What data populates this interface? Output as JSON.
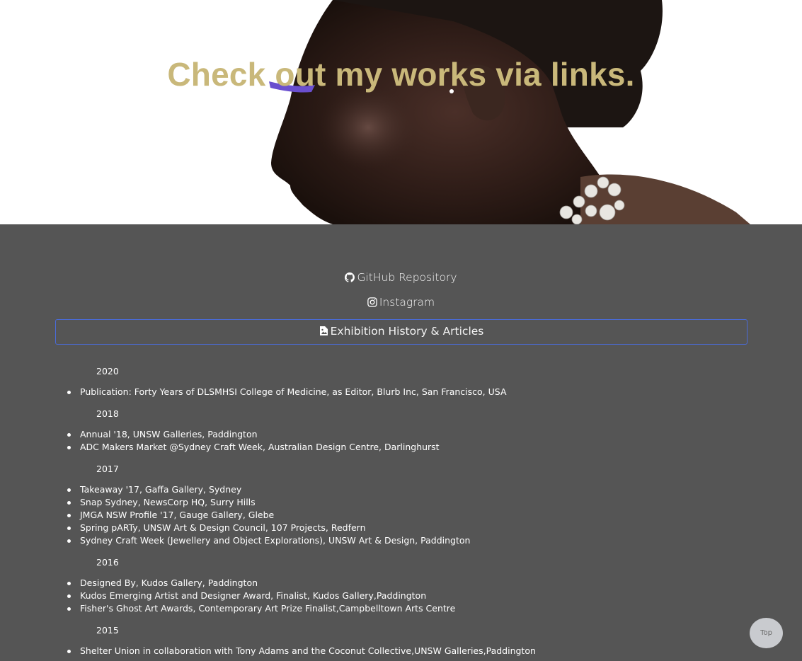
{
  "hero": {
    "title": "Check out my works via links."
  },
  "links": {
    "github": {
      "label": "GitHub Repository",
      "icon": "github-icon"
    },
    "instagram": {
      "label": "Instagram",
      "icon": "instagram-icon"
    },
    "exhibition": {
      "label": "Exhibition History & Articles",
      "icon": "image-file-icon"
    }
  },
  "history": [
    {
      "year": "2020",
      "items": [
        "Publication: Forty Years of DLSMHSI College of Medicine, as Editor, Blurb Inc, San Francisco, USA"
      ]
    },
    {
      "year": "2018",
      "items": [
        "Annual '18, UNSW Galleries, Paddington",
        "ADC Makers Market @Sydney Craft Week, Australian Design Centre, Darlinghurst"
      ]
    },
    {
      "year": "2017",
      "items": [
        "Takeaway '17, Gaffa Gallery, Sydney",
        "Snap Sydney, NewsCorp HQ, Surry Hills",
        "JMGA NSW Profile '17, Gauge Gallery, Glebe",
        "Spring pARTy, UNSW Art & Design Council, 107 Projects, Redfern",
        "Sydney Craft Week (Jewellery and Object Explorations), UNSW Art & Design, Paddington"
      ]
    },
    {
      "year": "2016",
      "items": [
        "Designed By, Kudos Gallery, Paddington",
        "Kudos Emerging Artist and Designer Award, Finalist, Kudos Gallery,Paddington",
        "Fisher's Ghost Art Awards, Contemporary Art Prize Finalist,Campbelltown Arts Centre"
      ]
    },
    {
      "year": "2015",
      "items": [
        "Shelter Union in collaboration with Tony Adams and the Coconut Collective,UNSW Galleries,Paddington"
      ]
    }
  ],
  "top_button": {
    "label": "Top"
  },
  "colors": {
    "background": "#555555",
    "title": "#c9b87a",
    "border_accent": "#4a6bd8"
  }
}
